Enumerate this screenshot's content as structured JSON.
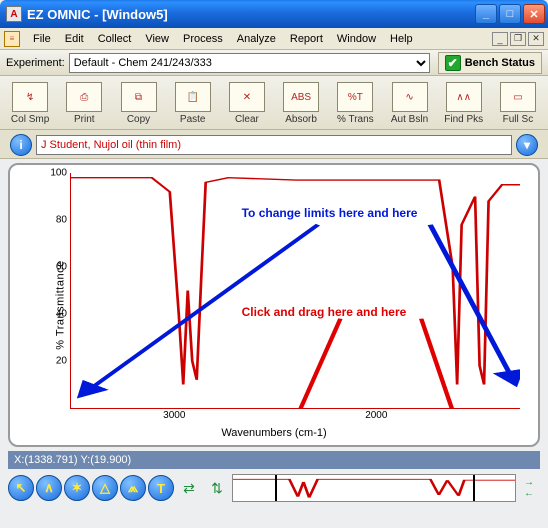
{
  "window": {
    "title": "EZ OMNIC - [Window5]"
  },
  "menu": {
    "items": [
      "File",
      "Edit",
      "Collect",
      "View",
      "Process",
      "Analyze",
      "Report",
      "Window",
      "Help"
    ]
  },
  "experiment": {
    "label": "Experiment:",
    "value": "Default - Chem 241/243/333",
    "bench_status": "Bench Status"
  },
  "toolbar": {
    "items": [
      {
        "label": "Col Smp",
        "glyph": "↯"
      },
      {
        "label": "Print",
        "glyph": "⎙"
      },
      {
        "label": "Copy",
        "glyph": "⧉"
      },
      {
        "label": "Paste",
        "glyph": "📋"
      },
      {
        "label": "Clear",
        "glyph": "✕"
      },
      {
        "label": "Absorb",
        "glyph": "ABS"
      },
      {
        "label": "% Trans",
        "glyph": "%T"
      },
      {
        "label": "Aut Bsln",
        "glyph": "∿"
      },
      {
        "label": "Find Pks",
        "glyph": "∧∧"
      },
      {
        "label": "Full Sc",
        "glyph": "▭"
      }
    ]
  },
  "info": {
    "sample": "J Student, Nujol oil (thin film)"
  },
  "chart_data": {
    "type": "line",
    "title": "",
    "xlabel": "Wavenumbers (cm-1)",
    "ylabel": "% Transmittance",
    "xlim": [
      3500,
      1300
    ],
    "ylim": [
      0,
      100
    ],
    "xticks": [
      3000,
      2000
    ],
    "yticks": [
      20,
      40,
      60,
      80,
      100
    ],
    "annotations": [
      {
        "text": "To change limits here and here",
        "color": "blue"
      },
      {
        "text": "Click and drag here and here",
        "color": "red"
      }
    ],
    "series": [
      {
        "name": "Nujol oil",
        "color": "#c00",
        "x": [
          3500,
          3100,
          3000,
          2960,
          2930,
          2900,
          2870,
          2850,
          2830,
          2800,
          2700,
          2400,
          2000,
          1500,
          1470,
          1460,
          1450,
          1390,
          1380,
          1370,
          1360,
          1320
        ],
        "y": [
          98,
          98,
          92,
          40,
          10,
          50,
          20,
          12,
          55,
          96,
          98,
          97,
          97,
          97,
          60,
          10,
          78,
          90,
          18,
          10,
          88,
          95
        ]
      }
    ]
  },
  "status": {
    "text": "X:(1338.791) Y:(19.900)"
  },
  "bottom_icons": {
    "labels": [
      "home",
      "expand",
      "center",
      "peak-up",
      "peak-both",
      "text"
    ]
  }
}
